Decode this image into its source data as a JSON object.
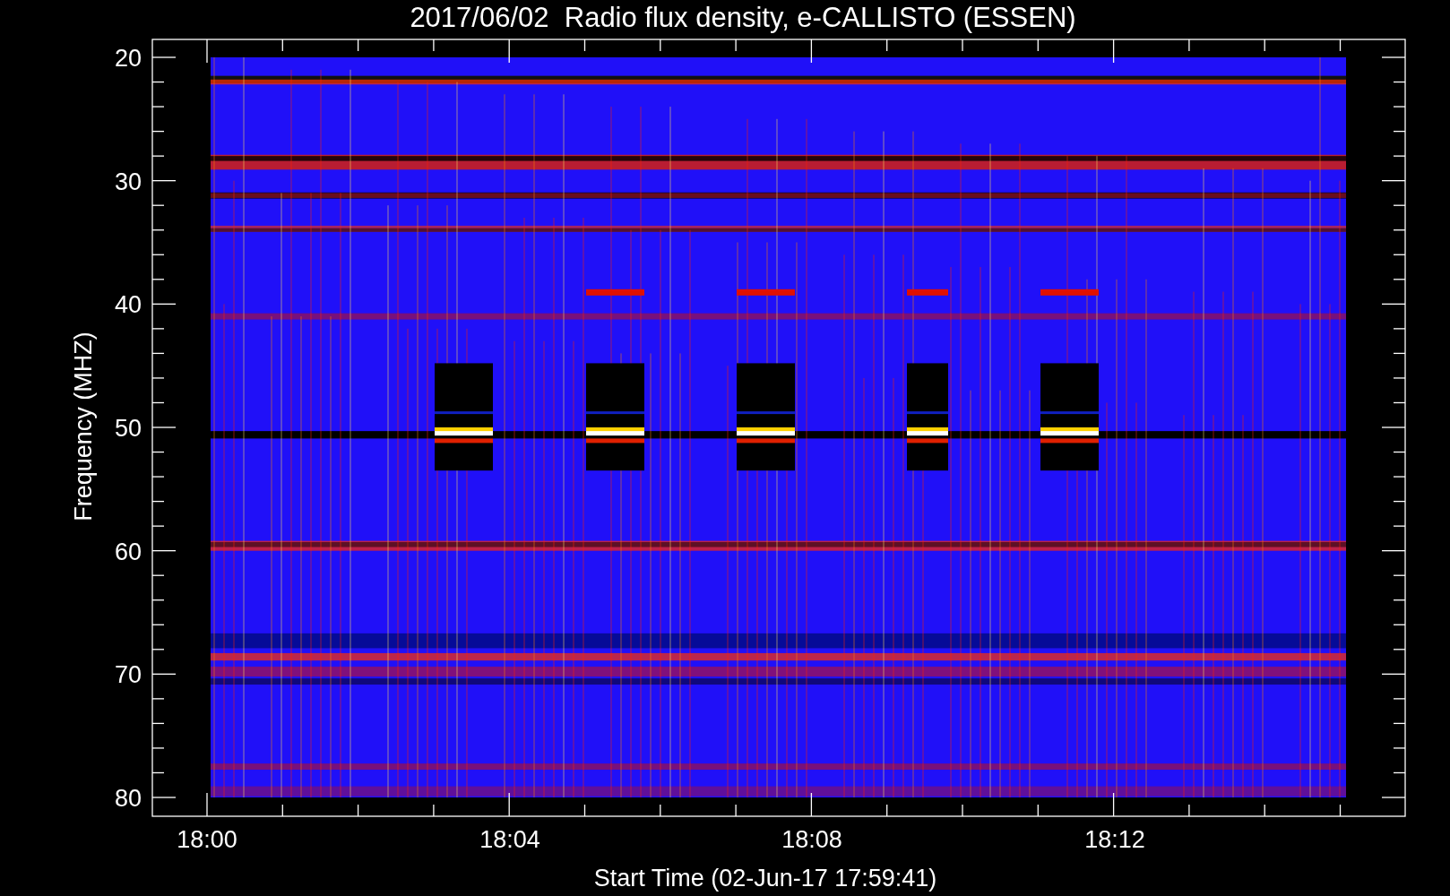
{
  "title": "2017/06/02  Radio flux density, e-CALLISTO (ESSEN)",
  "y_axis": {
    "label": "Frequency (MHZ)",
    "ticks": [
      "20",
      "30",
      "40",
      "50",
      "60",
      "70",
      "80"
    ]
  },
  "x_axis": {
    "label": "Start Time (02-Jun-17 17:59:41)",
    "ticks": [
      "18:00",
      "18:04",
      "18:08",
      "18:12"
    ]
  }
}
